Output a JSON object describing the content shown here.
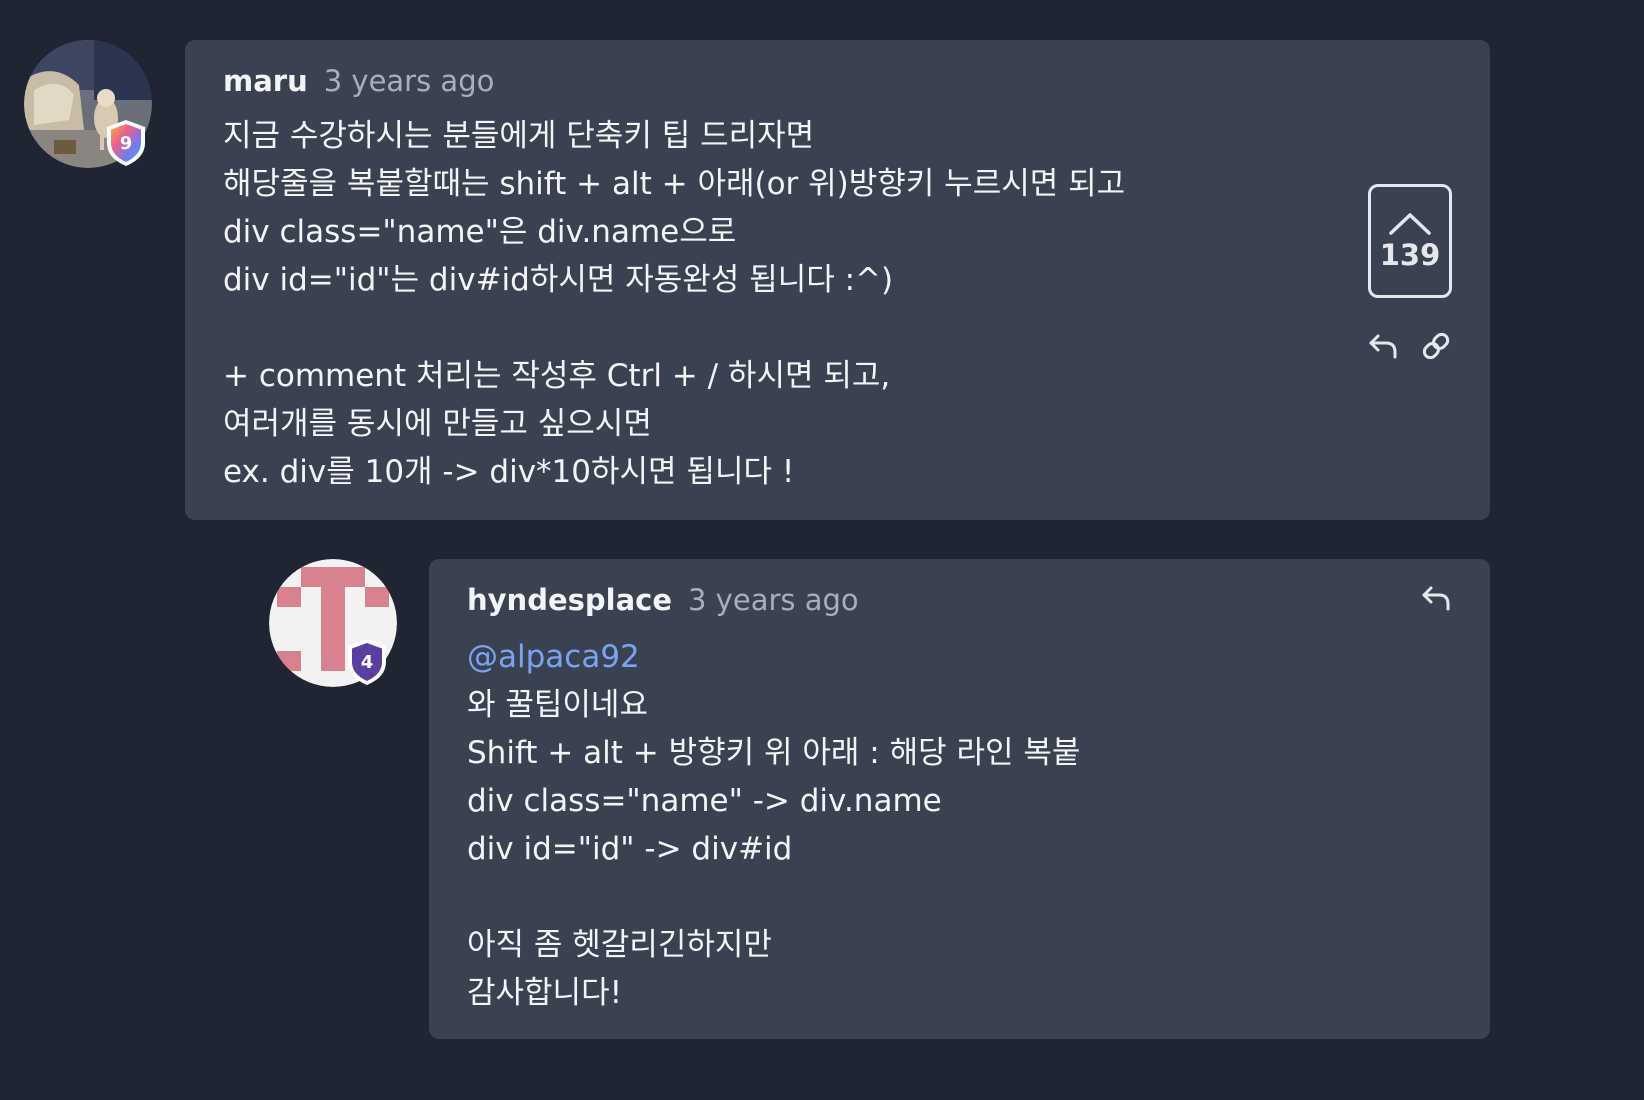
{
  "comments": [
    {
      "author": "maru",
      "time": "3 years ago",
      "badge_level": "9",
      "lines": [
        "지금 수강하시는 분들에게 단축키 팁 드리자면",
        "해당줄을 복붙할때는 shift + alt + 아래(or 위)방향키 누르시면 되고",
        "div class=\"name\"은 div.name으로",
        "div id=\"id\"는 div#id하시면 자동완성 됩니다 :^)",
        "",
        "+ comment 처리는 작성후 Ctrl + / 하시면 되고,",
        "여러개를 동시에 만들고 싶으시면",
        "ex. div를 10개 -> div*10하시면 됩니다 !"
      ],
      "vote_count": "139"
    },
    {
      "author": "hyndesplace",
      "time": "3 years ago",
      "badge_level": "4",
      "mention": "@alpaca92",
      "lines": [
        "와 꿀팁이네요",
        "Shift + alt + 방향키 위 아래 : 해당 라인 복붙",
        "div class=\"name\" -> div.name",
        "div id=\"id\" -> div#id",
        "",
        "아직 좀 헷갈리긴하지만",
        "감사합니다!"
      ]
    }
  ],
  "icons": {
    "upvote": "chevron-up-icon",
    "reply": "reply-icon",
    "link": "link-icon",
    "badge": "shield-badge-icon"
  },
  "colors": {
    "background": "#1f2533",
    "card": "#3a4150",
    "mention": "#7aa3f5",
    "avatar_identicon": "#d9828f"
  }
}
